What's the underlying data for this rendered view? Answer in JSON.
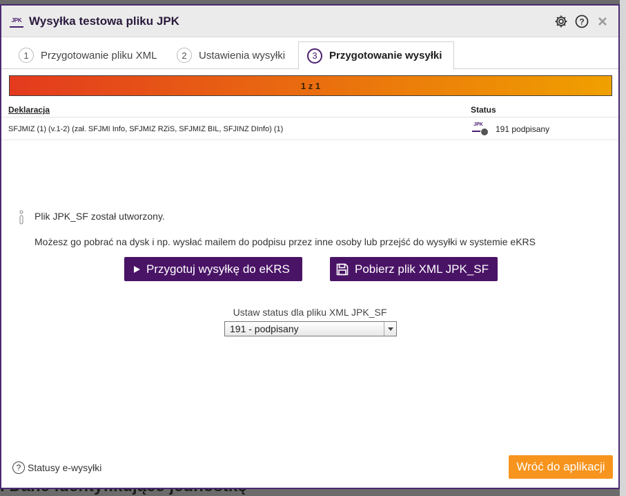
{
  "background": {
    "heading": ". Dane identyfikujące jednostkę"
  },
  "dialog": {
    "logo_text": "JPK",
    "title": "Wysyłka testowa pliku JPK",
    "icons": [
      "gear-icon",
      "help-icon",
      "close-icon"
    ]
  },
  "tabs": [
    {
      "number": "1",
      "label": "Przygotowanie pliku XML",
      "active": false
    },
    {
      "number": "2",
      "label": "Ustawienia wysyłki",
      "active": false
    },
    {
      "number": "3",
      "label": "Przygotowanie wysyłki",
      "active": true
    }
  ],
  "progress": {
    "label": "1 z 1",
    "current": 1,
    "total": 1,
    "fraction": 1.0,
    "colors": [
      "#e33a1e",
      "#f0a000"
    ]
  },
  "table": {
    "headers": {
      "declaration": "Deklaracja",
      "status": "Status"
    },
    "rows": [
      {
        "declaration": "SFJMIZ (1) (v.1-2) (zał. SFJMI Info, SFJMIZ RZiS, SFJMIZ BIL, SFJINZ DInfo) (1)",
        "status_icon_text": "JPK",
        "status": "191 podpisany"
      }
    ]
  },
  "info": {
    "line1": "Plik JPK_SF został utworzony.",
    "line2": "Możesz go pobrać na dysk i np. wysłać mailem do podpisu przez inne osoby lub przejść do wysyłki w systemie eKRS"
  },
  "buttons": {
    "prepare_ekrs": "Przygotuj wysyłkę do eKRS",
    "download_xml": "Pobierz plik XML JPK_SF",
    "back": "Wróć do aplikacji"
  },
  "status_select": {
    "label": "Ustaw status dla pliku XML JPK_SF",
    "value": "191 - podpisany"
  },
  "footer": {
    "help_link": "Statusy e-wysyłki"
  },
  "colors": {
    "brand_purple": "#4a1466",
    "accent_orange": "#f7941d",
    "progress_start": "#e33a1e",
    "progress_end": "#f0a000"
  }
}
